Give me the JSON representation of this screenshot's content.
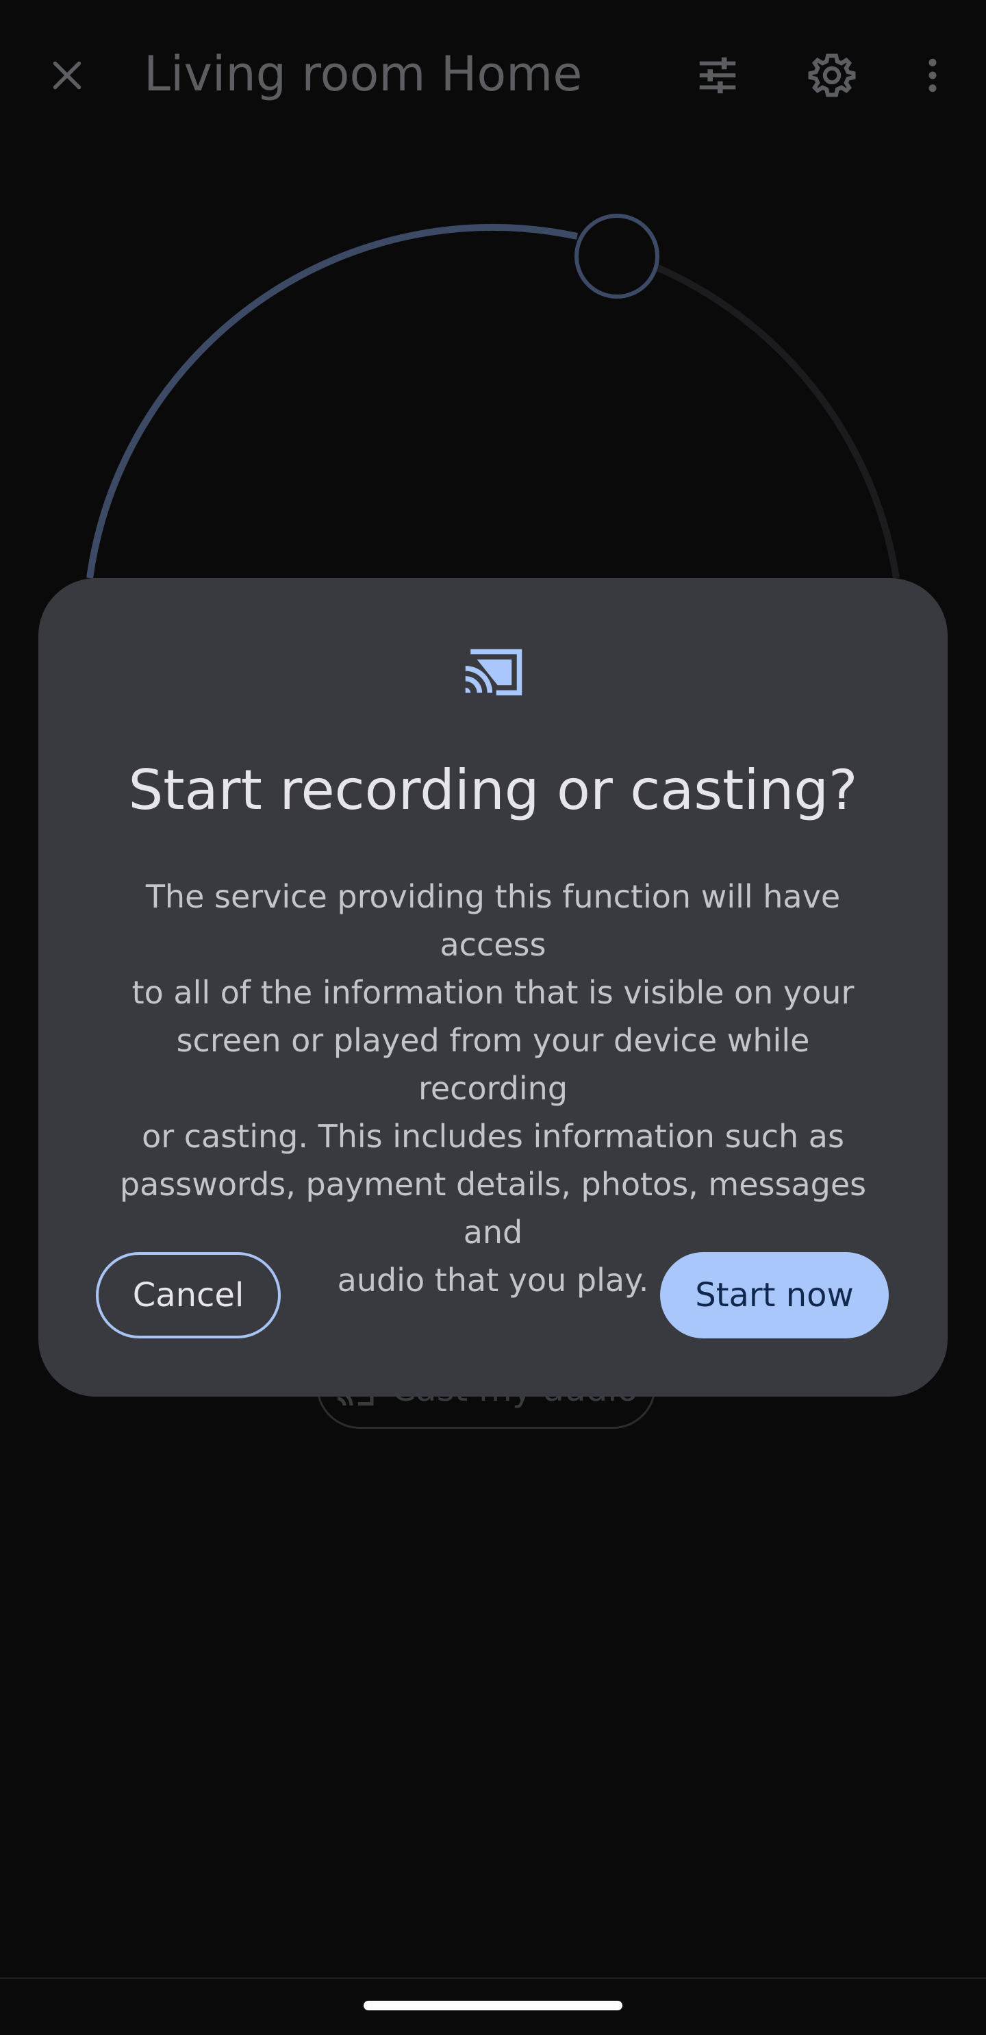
{
  "app_bar": {
    "title": "Living room Home",
    "icons": {
      "close": "close-icon",
      "tune": "tune-icon",
      "settings": "gear-icon",
      "more": "more-vert-icon"
    }
  },
  "background": {
    "cast_audio_label": "Cast my audio"
  },
  "dialog": {
    "icon": "cast-icon",
    "title": "Start recording or casting?",
    "body_lines": [
      "The service providing this function will have access",
      "to all of the information that is visible on your",
      "screen or played from your device while recording",
      "or casting. This includes information such as",
      "passwords, payment details, photos, messages and",
      "audio that you play."
    ],
    "cancel_label": "Cancel",
    "start_label": "Start now"
  },
  "colors": {
    "background": "#0a0a0b",
    "dialog": "#393a40",
    "accent": "#a9c7fa",
    "accent_text": "#10284d",
    "dial_active": "#3d4a66",
    "dial_inactive": "#1c1c1e"
  }
}
